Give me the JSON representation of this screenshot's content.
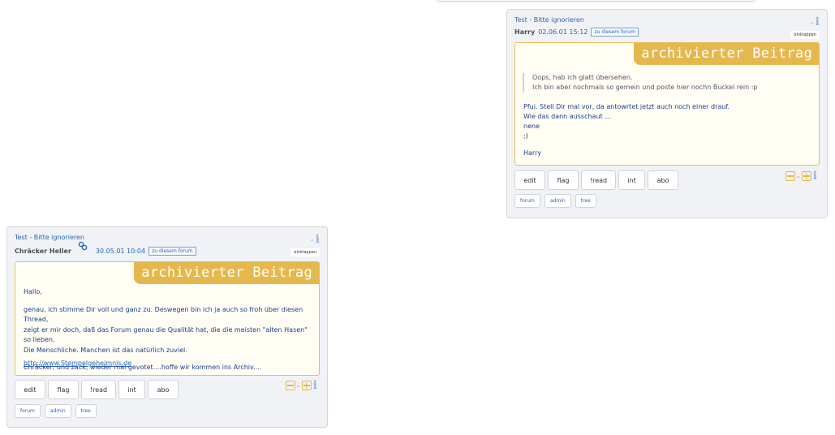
{
  "posts": [
    {
      "title": "Test - Bitte ignorieren",
      "author": "Harry",
      "date": "02.06.01 15:12",
      "forum_chip": "zu diesem forum",
      "collapse_label": "einklappen",
      "archived_label": "archivierter Beitrag",
      "quote_lines": [
        "Oops, hab ich glatt übersehen.",
        "Ich bin aber nochmals so gemein und poste hier nochn Buckel rein :p"
      ],
      "body_lines": [
        "Pfui. Stell Dir mal vor, da antowrtet jetzt auch noch einer drauf.",
        "Wie das dann ausschaut ...",
        "nene",
        ";)"
      ],
      "signature": "Harry",
      "buttons": [
        "edit",
        "flag",
        "!read",
        "int",
        "abo"
      ],
      "chips": [
        "forum",
        "admin",
        "tree"
      ]
    },
    {
      "title": "Test - Bitte ignorieren",
      "author": "Chräcker Heller",
      "date": "30.05.01 10:04",
      "forum_chip": "zu diesem forum",
      "collapse_label": "einklappen",
      "archived_label": "archivierter Beitrag",
      "greeting": "Hallo,",
      "paragraph_lines": [
        "genau, ich stimme Dir voll und ganz zu. Deswegen bin ich ja auch so froh über diesen Thread,",
        "zeigt er mir doch, daß das Forum genau die Qualität hat, die die meisten \"alten Hasen\" so lieben.",
        "Die Menschliche. Manchen ist das natürlich zuviel."
      ],
      "closing": "Chräcker, und zack, wieder mal gevotet....hoffe wir kommen ins Archiv....",
      "url": "http://www.Stempelgeheimnis.de",
      "buttons": [
        "edit",
        "flag",
        "!read",
        "int",
        "abo"
      ],
      "chips": [
        "forum",
        "admin",
        "tree"
      ]
    }
  ],
  "icons": {
    "dash": "-",
    "info": "i",
    "link": "🔗"
  },
  "colors": {
    "accent": "#e5b84e",
    "link": "#2a66b5",
    "panel": "#f0f2f5"
  }
}
